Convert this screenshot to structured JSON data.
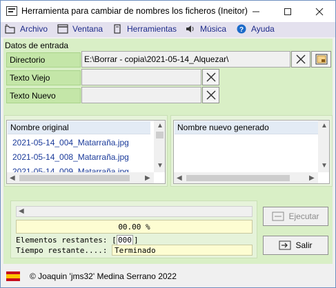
{
  "window": {
    "title": "Herramienta para cambiar de nombres los ficheros (Ineitor)"
  },
  "menu": [
    {
      "label": "Archivo",
      "icon": "file-icon"
    },
    {
      "label": "Ventana",
      "icon": "window-icon"
    },
    {
      "label": "Herramientas",
      "icon": "tools-icon"
    },
    {
      "label": "Música",
      "icon": "speaker-icon"
    },
    {
      "label": "Ayuda",
      "icon": "help-icon"
    }
  ],
  "input_group": {
    "title": "Datos de entrada",
    "directory_label": "Directorio",
    "directory_value": "E:\\Borrar - copia\\2021-05-14_Alquezar\\",
    "old_text_label": "Texto Viejo",
    "old_text_value": "",
    "new_text_label": "Texto Nuevo",
    "new_text_value": ""
  },
  "original_list": {
    "header": "Nombre original",
    "items": [
      "2021-05-14_004_Matarraña.jpg",
      "2021-05-14_008_Matarraña.jpg",
      "2021-05-14_009_Matarraña.jpg"
    ]
  },
  "generated_list": {
    "header": "Nombre nuevo generado",
    "items": []
  },
  "progress": {
    "percent_text": "00.00 %",
    "remaining_label": "Elementos restantes: [",
    "remaining_value": "000",
    "remaining_close": "]",
    "time_label": "Tiempo restante....:",
    "time_value": "Terminado"
  },
  "buttons": {
    "execute": "Ejecutar",
    "exit": "Salir"
  },
  "footer": {
    "copyright": "© Joaquin 'jms32' Medina Serrano 2022"
  },
  "colors": {
    "background_green": "#d9efc6",
    "label_green": "#c4e6a8",
    "menu_text": "#1e2b8a",
    "progress_value_bg": "#fdfdd2"
  }
}
